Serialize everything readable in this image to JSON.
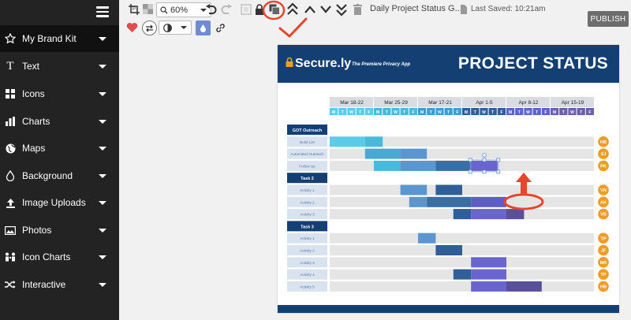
{
  "sidebar": {
    "items": [
      {
        "label": "My Brand Kit",
        "icon": "star-icon"
      },
      {
        "label": "Text",
        "icon": "text-icon"
      },
      {
        "label": "Icons",
        "icon": "icons-grid-icon"
      },
      {
        "label": "Charts",
        "icon": "bar-chart-icon"
      },
      {
        "label": "Maps",
        "icon": "globe-icon"
      },
      {
        "label": "Background",
        "icon": "droplet-icon"
      },
      {
        "label": "Image Uploads",
        "icon": "upload-icon"
      },
      {
        "label": "Photos",
        "icon": "photo-icon"
      },
      {
        "label": "Icon Charts",
        "icon": "people-icon"
      },
      {
        "label": "Interactive",
        "icon": "shuffle-icon"
      }
    ]
  },
  "toolbar": {
    "zoom": "60%",
    "doc_title": "Daily Project Status G...",
    "saved": "Last Saved: 10:21am",
    "publish": "PUBLISH"
  },
  "infographic": {
    "brand": "Secure.ly",
    "tagline": "The Premiere Privacy App",
    "title": "PROJECT STATUS",
    "weeks": [
      "Mar 18-22",
      "Mar 25-29",
      "Mar 17-21",
      "Apr 1-5",
      "Apr 8-12",
      "Apr 15-19"
    ],
    "days": [
      "M",
      "T",
      "W",
      "T",
      "F"
    ],
    "groups": [
      {
        "name": "GOT Outreach",
        "rows": [
          {
            "label": "Build List",
            "initials": "HB",
            "bars": [
              [
                0,
                4,
                "#5ccaea"
              ],
              [
                4,
                6,
                "#49b9d9"
              ]
            ]
          },
          {
            "label": "Automated Outreach",
            "initials": "SJ",
            "bars": [
              [
                4,
                8,
                "#47a9d4"
              ],
              [
                8,
                11,
                "#5b96d0"
              ]
            ]
          },
          {
            "label": "Follow Up",
            "initials": "PK",
            "bars": [
              [
                5,
                8,
                "#49b9d9"
              ],
              [
                8,
                12,
                "#5b96d0"
              ],
              [
                12,
                16,
                "#3a6ea6"
              ],
              [
                16,
                19,
                "#6a64cf"
              ]
            ]
          }
        ]
      },
      {
        "name": "Task 2",
        "rows": [
          {
            "label": "Activity 1",
            "initials": "VN",
            "bars": [
              [
                8,
                11,
                "#5b96d0"
              ],
              [
                12,
                15,
                "#2f5f96"
              ]
            ]
          },
          {
            "label": "Activity 2",
            "initials": "AK",
            "bars": [
              [
                9,
                11,
                "#5b96d0"
              ],
              [
                11,
                16,
                "#3a6ea6"
              ],
              [
                16,
                20,
                "#5c5ec6"
              ]
            ]
          },
          {
            "label": "Activity 3",
            "initials": "VB",
            "bars": [
              [
                14,
                16,
                "#2f5f96"
              ],
              [
                16,
                20,
                "#6a64cf"
              ],
              [
                20,
                22,
                "#5a4f9a"
              ]
            ]
          }
        ]
      },
      {
        "name": "Task 3",
        "rows": [
          {
            "label": "Activity 1",
            "initials": "TP",
            "bars": [
              [
                10,
                12,
                "#5b96d0"
              ]
            ]
          },
          {
            "label": "Activity 2",
            "initials": "JF",
            "bars": [
              [
                12,
                15,
                "#2f5f96"
              ]
            ]
          },
          {
            "label": "Activity 3",
            "initials": "MR",
            "bars": [
              [
                16,
                20,
                "#6a64cf"
              ]
            ]
          },
          {
            "label": "Activity 4",
            "initials": "TP",
            "bars": [
              [
                14,
                16,
                "#2f5f96"
              ],
              [
                16,
                20,
                "#6a64cf"
              ]
            ]
          },
          {
            "label": "Activity 5",
            "initials": "HB",
            "bars": [
              [
                16,
                20,
                "#6a64cf"
              ],
              [
                20,
                24,
                "#5a4f9a"
              ]
            ]
          }
        ]
      }
    ],
    "week_colors": [
      "#5ccaea",
      "#49b9d9",
      "#3d9cd0",
      "#2f5f96",
      "#5d63c9",
      "#6a5fa8"
    ],
    "avatar_color": "#f39b22",
    "navy": "#143f73"
  },
  "colors": {
    "annotation": "#e8452c",
    "accent": "#f39b22"
  }
}
